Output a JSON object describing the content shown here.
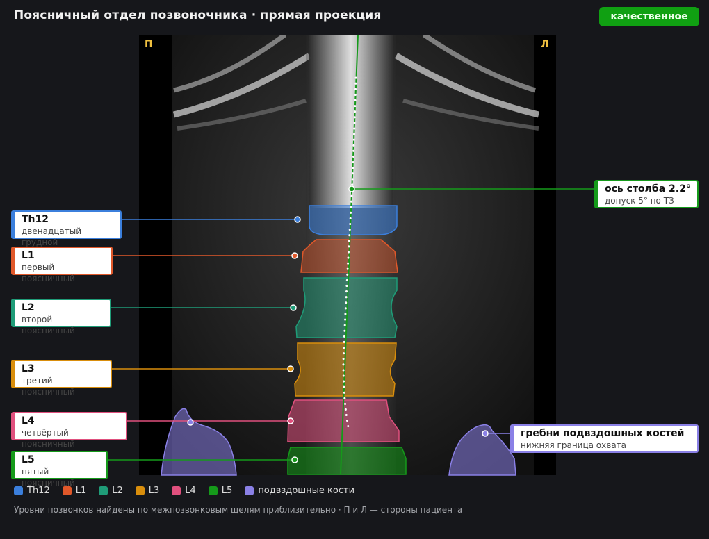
{
  "header": {
    "title": "Поясничный отдел позвоночника · прямая проекция",
    "status_badge": "качественное"
  },
  "scan": {
    "side_right": "П",
    "side_left": "Л"
  },
  "colors": {
    "th12": "#3b7fdc",
    "l1": "#e0582a",
    "l2": "#1f9c78",
    "l3": "#d98e0c",
    "l4": "#e0507e",
    "l5": "#159a1a",
    "iliac": "#8a80e6",
    "axis": "#159a1a"
  },
  "vertebrae": [
    {
      "key": "th12",
      "label": "Th12",
      "description": "двенадцатый грудной",
      "icon": "circle-marker-icon"
    },
    {
      "key": "l1",
      "label": "L1",
      "description": "первый поясничный",
      "icon": "circle-marker-icon"
    },
    {
      "key": "l2",
      "label": "L2",
      "description": "второй поясничный",
      "icon": "circle-marker-icon"
    },
    {
      "key": "l3",
      "label": "L3",
      "description": "третий поясничный",
      "icon": "circle-marker-icon"
    },
    {
      "key": "l4",
      "label": "L4",
      "description": "четвёртый поясничный",
      "icon": "circle-marker-icon"
    },
    {
      "key": "l5",
      "label": "L5",
      "description": "пятый поясничный",
      "icon": "circle-marker-icon"
    }
  ],
  "axis_callout": {
    "title": "ось столба 2.2°",
    "subtitle": "допуск 5° по ТЗ",
    "angle_deg": 2.2,
    "tolerance_deg": 5
  },
  "iliac_callout": {
    "title": "гребни подвздошных костей",
    "subtitle": "нижняя граница охвата"
  },
  "legend": [
    {
      "key": "th12",
      "label": "Th12"
    },
    {
      "key": "l1",
      "label": "L1"
    },
    {
      "key": "l2",
      "label": "L2"
    },
    {
      "key": "l3",
      "label": "L3"
    },
    {
      "key": "l4",
      "label": "L4"
    },
    {
      "key": "l5",
      "label": "L5"
    },
    {
      "key": "iliac",
      "label": "подвздошные кости"
    }
  ],
  "footnote": "Уровни позвонков найдены по межпозвонковым щелям приблизительно · П и Л — стороны пациента"
}
